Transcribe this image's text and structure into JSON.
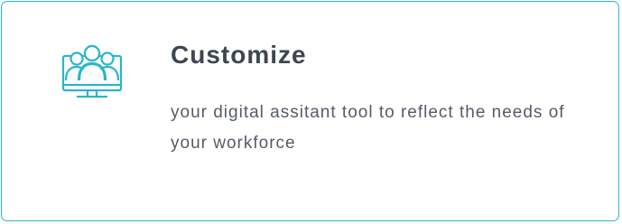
{
  "card": {
    "icon": "users-monitor-icon",
    "title": "Customize",
    "description": "your digital assitant tool to reflect the needs of your workforce"
  },
  "colors": {
    "accent": "#2bb5c9",
    "title": "#3d4652",
    "text": "#555c66"
  }
}
